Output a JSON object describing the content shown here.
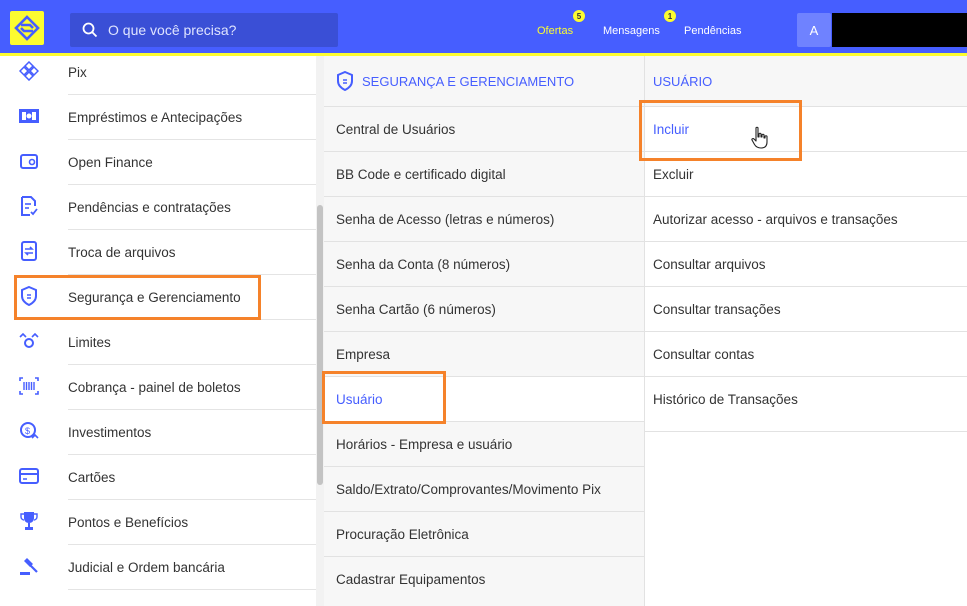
{
  "header": {
    "search_placeholder": "O que você precisa?",
    "links": [
      {
        "label": "Ofertas",
        "badge": "5"
      },
      {
        "label": "Mensagens",
        "badge": "1"
      },
      {
        "label": "Pendências",
        "badge": ""
      }
    ],
    "avatar_initial": "A"
  },
  "sidebar": {
    "items": [
      {
        "label": "Pix",
        "icon": "pix-icon"
      },
      {
        "label": "Empréstimos e Antecipações",
        "icon": "money-icon"
      },
      {
        "label": "Open Finance",
        "icon": "wallet-icon"
      },
      {
        "label": "Pendências e contratações",
        "icon": "document-check-icon"
      },
      {
        "label": "Troca de arquivos",
        "icon": "file-transfer-icon"
      },
      {
        "label": "Segurança e Gerenciamento",
        "icon": "shield-icon"
      },
      {
        "label": "Limites",
        "icon": "limits-icon"
      },
      {
        "label": "Cobrança - painel de boletos",
        "icon": "barcode-icon"
      },
      {
        "label": "Investimentos",
        "icon": "investment-icon"
      },
      {
        "label": "Cartões",
        "icon": "card-icon"
      },
      {
        "label": "Pontos e Benefícios",
        "icon": "trophy-icon"
      },
      {
        "label": "Judicial e Ordem bancária",
        "icon": "gavel-icon"
      }
    ]
  },
  "submenu": {
    "title": "SEGURANÇA E GERENCIAMENTO",
    "items": [
      "Central de Usuários",
      "BB Code e certificado digital",
      "Senha de Acesso (letras e números)",
      "Senha da Conta (8 números)",
      "Senha Cartão (6 números)",
      "Empresa",
      "Usuário",
      "Horários - Empresa e usuário",
      "Saldo/Extrato/Comprovantes/Movimento Pix",
      "Procuração Eletrônica",
      "Cadastrar Equipamentos"
    ]
  },
  "usuario_menu": {
    "title": "USUÁRIO",
    "items": [
      "Incluir",
      "Excluir",
      "Autorizar acesso - arquivos e transações",
      "Consultar arquivos",
      "Consultar transações",
      "Consultar contas",
      "Histórico de Transações"
    ]
  },
  "colors": {
    "brand_blue": "#465eff",
    "brand_yellow": "#fcfc30",
    "highlight_orange": "#f5822a"
  }
}
